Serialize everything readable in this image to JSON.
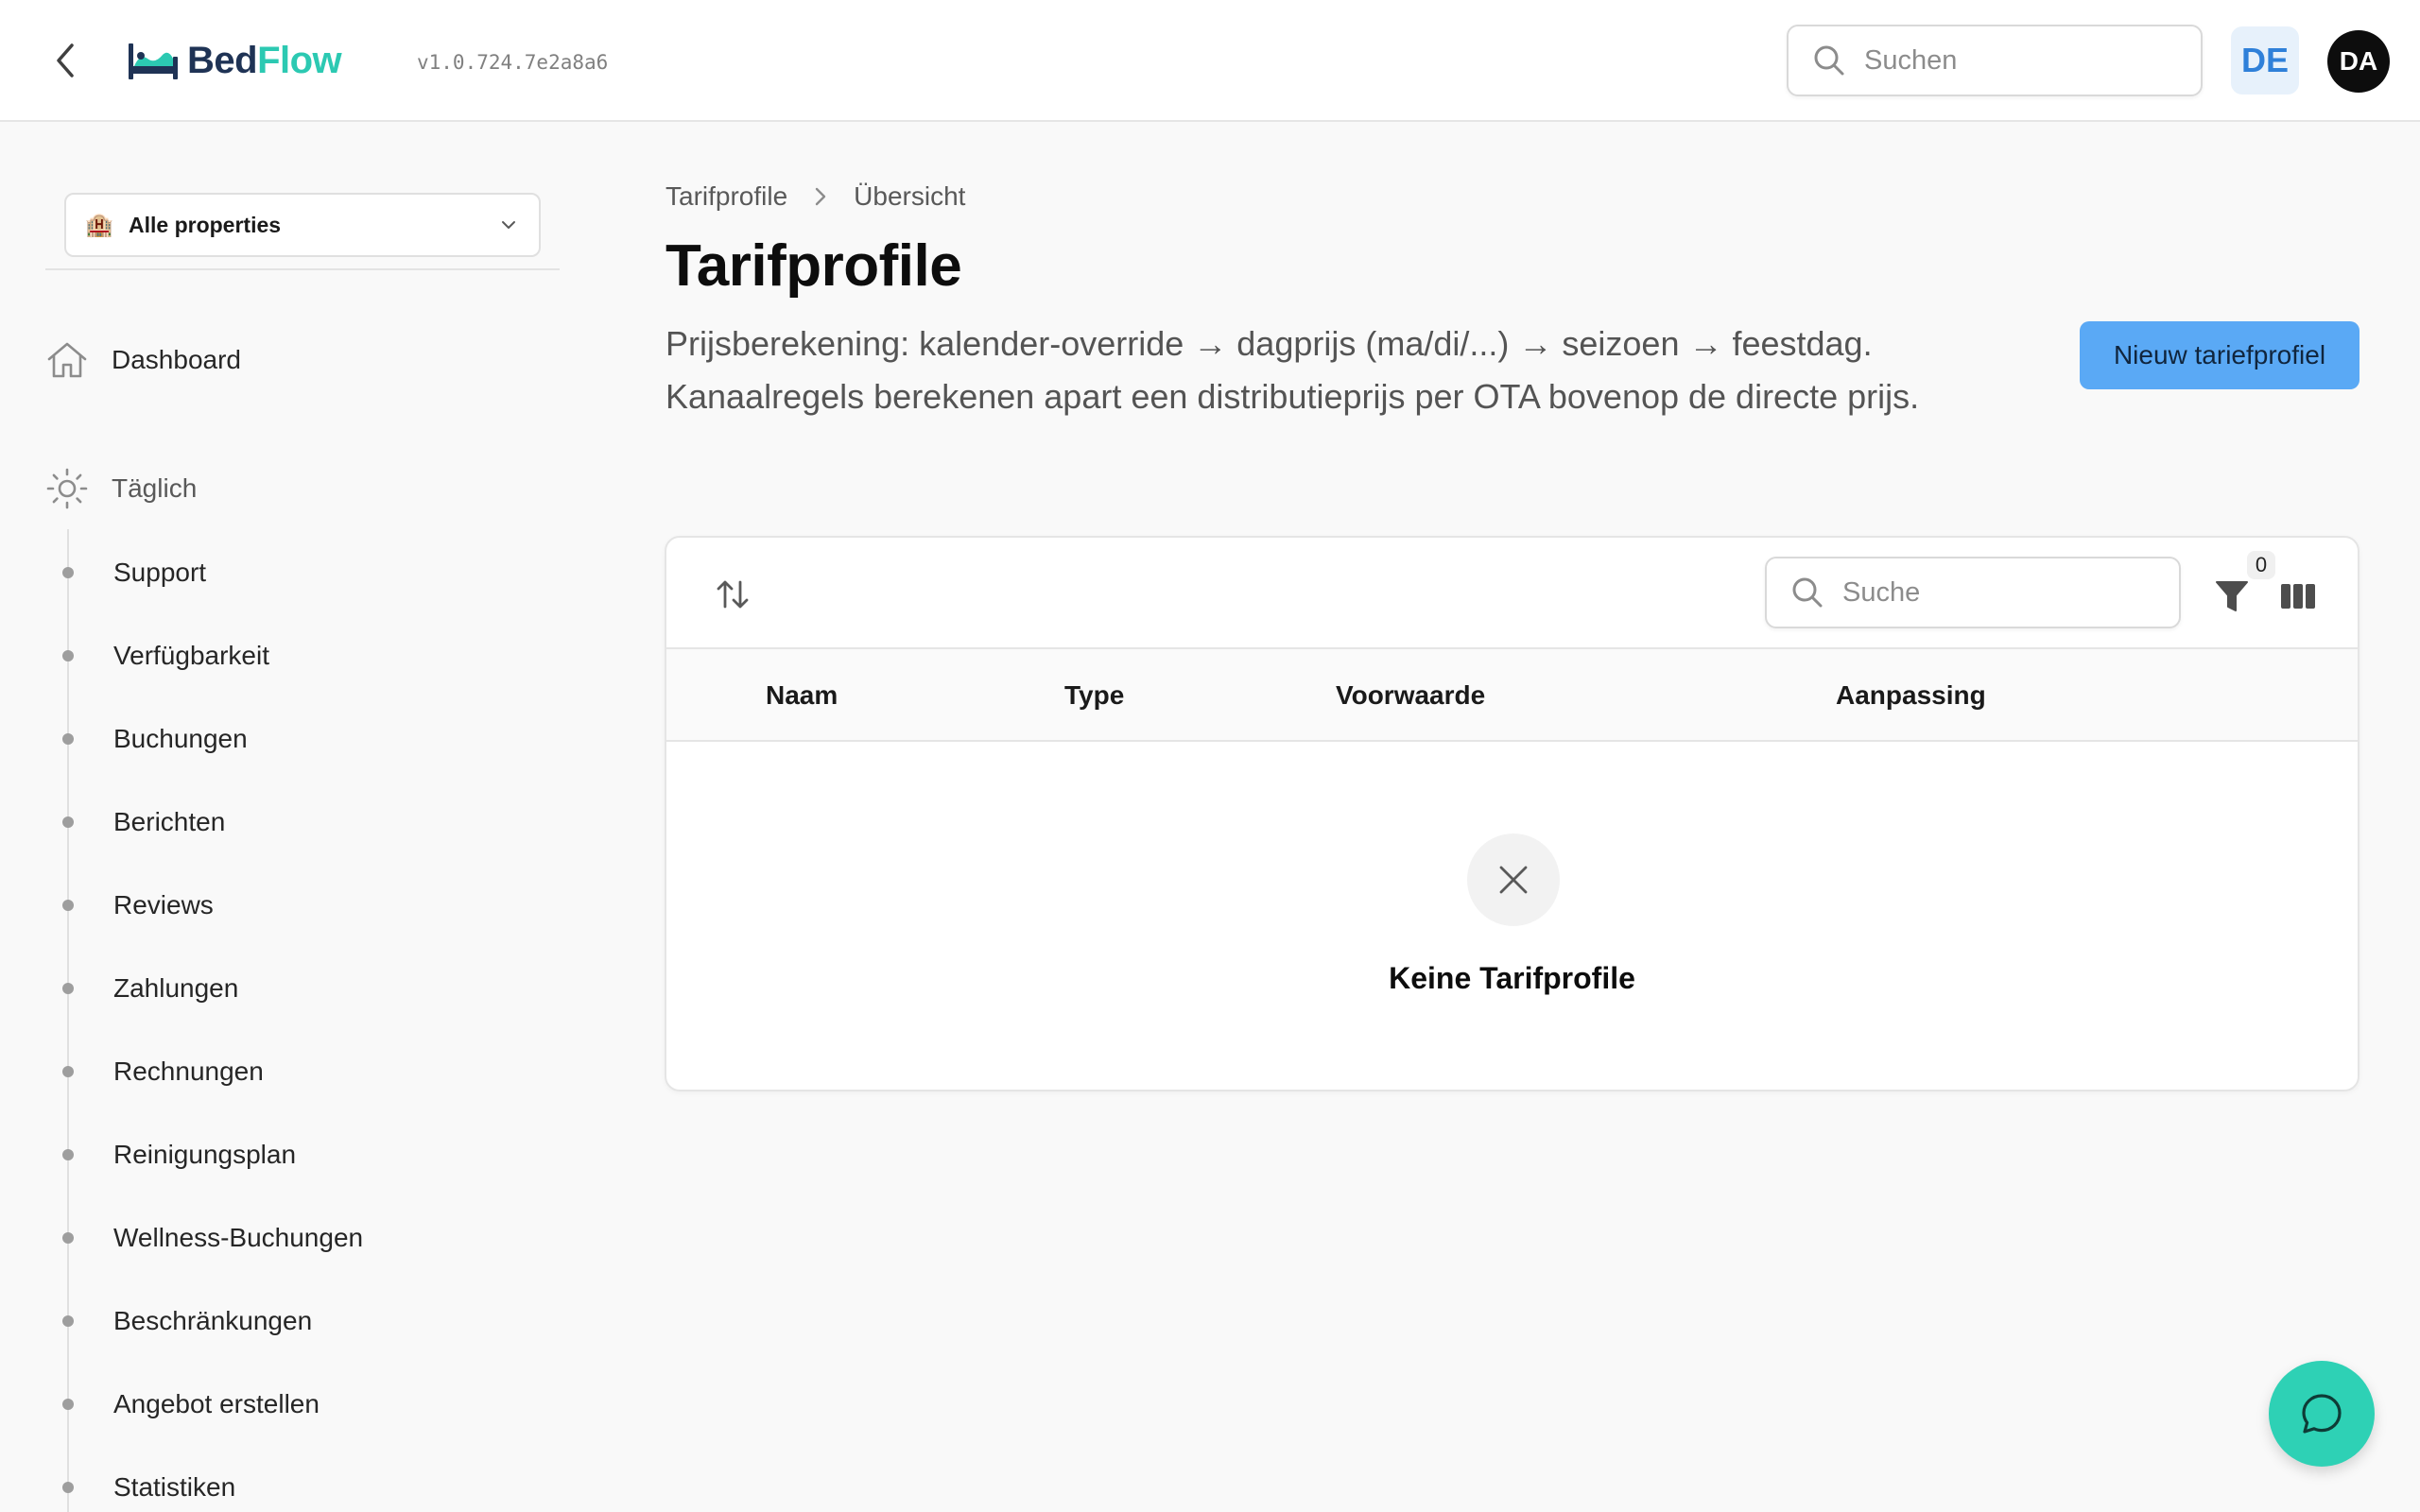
{
  "header": {
    "logo_part1": "Bed",
    "logo_part2": "Flow",
    "version": "v1.0.724.7e2a8a6",
    "search_placeholder": "Suchen",
    "language": "DE",
    "avatar_initials": "DA"
  },
  "sidebar": {
    "property_select": "Alle properties",
    "main_item": "Dashboard",
    "section_label": "Täglich",
    "items": [
      {
        "label": "Support"
      },
      {
        "label": "Verfügbarkeit"
      },
      {
        "label": "Buchungen"
      },
      {
        "label": "Berichten"
      },
      {
        "label": "Reviews"
      },
      {
        "label": "Zahlungen"
      },
      {
        "label": "Rechnungen"
      },
      {
        "label": "Reinigungsplan"
      },
      {
        "label": "Wellness-Buchungen"
      },
      {
        "label": "Beschränkungen"
      },
      {
        "label": "Angebot erstellen"
      },
      {
        "label": "Statistiken"
      }
    ]
  },
  "breadcrumb": {
    "parent": "Tarifprofile",
    "current": "Übersicht"
  },
  "page": {
    "title": "Tarifprofile",
    "description": "Prijsberekening: kalender-override → dagprijs (ma/di/...) → seizoen → feestdag. Kanaalregels berekenen apart een distributieprijs per OTA bovenop de directe prijs.",
    "new_button": "Nieuw tariefprofiel"
  },
  "table": {
    "search_placeholder": "Suche",
    "filter_count": "0",
    "columns": [
      "Naam",
      "Type",
      "Voorwaarde",
      "Aanpassing"
    ],
    "empty_message": "Keine Tarifprofile"
  },
  "colors": {
    "brand_dark": "#1f3355",
    "brand_teal": "#2cc9b2",
    "primary_button": "#5aa9f5",
    "chat_button": "#2ed1b5"
  }
}
